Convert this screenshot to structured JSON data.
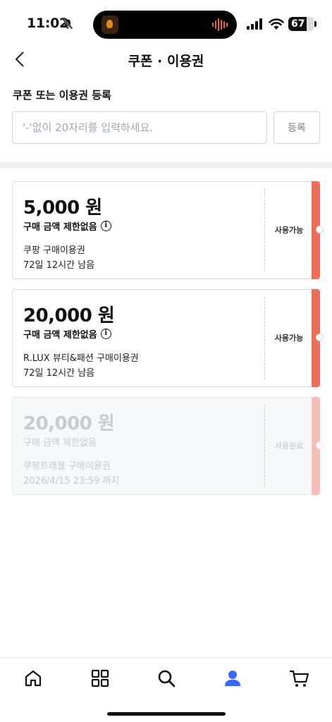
{
  "status_bar": {
    "time": "11:02",
    "battery": "67"
  },
  "header": {
    "title": "쿠폰 · 이용권"
  },
  "register": {
    "label": "쿠폰 또는 이용권 등록",
    "placeholder": "'-'없이 20자리를 입력하세요.",
    "button": "등록"
  },
  "coupons": [
    {
      "amount": "5,000 원",
      "condition": "구매 금액 제한없음",
      "name": "쿠팡 구매이용권",
      "remaining": "72일 12시간 남음",
      "status": "사용가능"
    },
    {
      "amount": "20,000 원",
      "condition": "구매 금액 제한없음",
      "name": "R.LUX 뷰티&패션 구매이용권",
      "remaining": "72일 12시간 남음",
      "status": "사용가능"
    },
    {
      "amount": "20,000 원",
      "condition": "구매 금액 제한없음",
      "name": "쿠팡트래블 구매이용권",
      "remaining": "2026/4/15 23:59 까지",
      "status": "사용완료"
    }
  ],
  "bottom_nav": {
    "items": [
      "home-icon",
      "category-grid-icon",
      "search-icon",
      "user-icon",
      "cart-icon"
    ],
    "active": "user-icon",
    "active_color": "#346aff"
  },
  "colors": {
    "accent_strip": "#ed6e5b",
    "accent_strip_used": "#f5bfb7"
  }
}
